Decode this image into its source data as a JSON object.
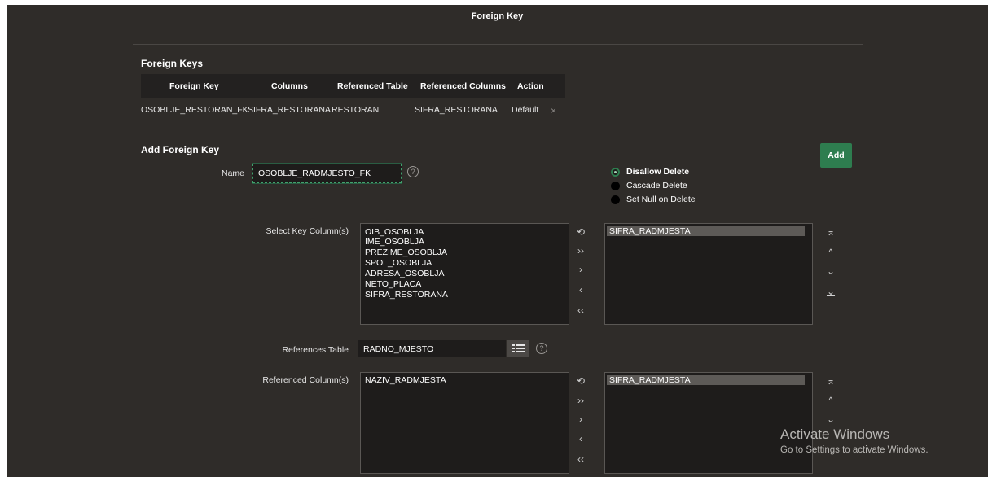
{
  "page_title": "Foreign Key",
  "foreign_keys": {
    "section_title": "Foreign Keys",
    "columns": [
      "Foreign Key",
      "Columns",
      "Referenced Table",
      "Referenced Columns",
      "Action"
    ],
    "rows": [
      {
        "foreign_key": "OSOBLJE_RESTORAN_FK",
        "columns": "SIFRA_RESTORANA",
        "referenced_table": "RESTORAN",
        "referenced_columns": "SIFRA_RESTORANA",
        "action": "Default",
        "delete_icon": "close-icon"
      }
    ]
  },
  "add_fk": {
    "section_title": "Add Foreign Key",
    "add_button": "Add",
    "name_label": "Name",
    "name_value": "OSOBLJE_RADMJESTO_FK",
    "help_glyph": "?",
    "delete_options": [
      {
        "label": "Disallow Delete",
        "selected": true
      },
      {
        "label": "Cascade Delete",
        "selected": false
      },
      {
        "label": "Set Null on Delete",
        "selected": false
      }
    ],
    "key_columns_label": "Select Key Column(s)",
    "available_key_columns": [
      "OIB_OSOBLJA",
      "IME_OSOBLJA",
      "PREZIME_OSOBLJA",
      "SPOL_OSOBLJA",
      "ADRESA_OSOBLJA",
      "NETO_PLACA",
      "SIFRA_RESTORANA"
    ],
    "selected_key_columns": [
      "SIFRA_RADMJESTA"
    ],
    "references_table_label": "References Table",
    "references_table_value": "RADNO_MJESTO",
    "referenced_columns_label": "Referenced Column(s)",
    "available_referenced_columns": [
      "NAZIV_RADMJESTA"
    ],
    "selected_referenced_columns": [
      "SIFRA_RADMJESTA"
    ],
    "shuttle_controls": {
      "reset": "⟲",
      "move_all": "››",
      "move": "›",
      "remove": "‹",
      "remove_all": "‹‹"
    },
    "order_controls": {
      "top": "⌅",
      "up": "^",
      "down": "⌄",
      "bottom": "⌄"
    }
  },
  "watermark": {
    "title": "Activate Windows",
    "subtitle": "Go to Settings to activate Windows."
  },
  "colors": {
    "background": "#2f2c29",
    "accent": "#2e7d4f",
    "header": "#232120"
  }
}
